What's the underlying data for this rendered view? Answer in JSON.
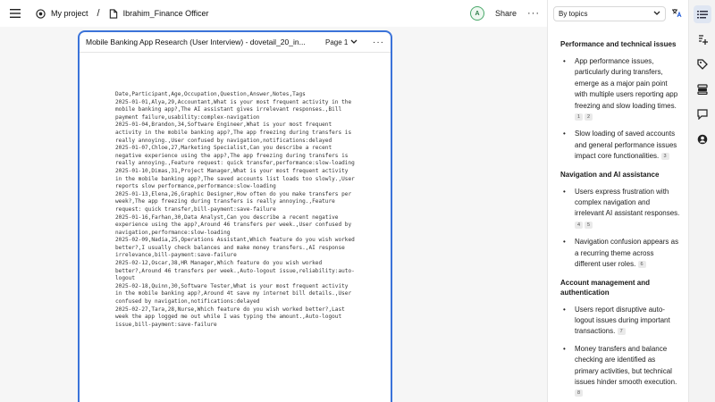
{
  "topbar": {
    "project": "My project",
    "separator": "/",
    "file": "Ibrahim_Finance Officer",
    "avatar_initial": "A",
    "share": "Share",
    "more": "···"
  },
  "document": {
    "title": "Mobile Banking App Research (User Interview) - dovetail_20_in...",
    "page_label": "Page 1",
    "more": "···",
    "csv": "Date,Participant,Age,Occupation,Question,Answer,Notes,Tags\n2025-01-01,Alya,29,Accountant,What is your most frequent activity in the mobile banking app?,The AI assistant gives irrelevant responses.,Bill payment failure,usability:complex-navigation\n2025-01-04,Brandon,34,Software Engineer,What is your most frequent activity in the mobile banking app?,The app freezing during transfers is really annoying.,User confused by navigation,notifications:delayed\n2025-01-07,Chloe,27,Marketing Specialist,Can you describe a recent negative experience using the app?,The app freezing during transfers is really annoying.,Feature request: quick transfer,performance:slow-loading\n2025-01-10,Dimas,31,Project Manager,What is your most frequent activity in the mobile banking app?,The saved accounts list loads too slowly.,User reports slow performance,performance:slow-loading\n2025-01-13,Elena,26,Graphic Designer,How often do you make transfers per week?,The app freezing during transfers is really annoying.,Feature request: quick transfer,bill-payment:save-failure\n2025-01-16,Farhan,30,Data Analyst,Can you describe a recent negative experience using the app?,Around 46 transfers per week.,User confused by navigation,performance:slow-loading\n2025-02-09,Nadia,25,Operations Assistant,Which feature do you wish worked better?,I usually check balances and make money transfers.,AI response irrelevance,bill-payment:save-failure\n2025-02-12,Oscar,38,HR Manager,Which feature do you wish worked better?,Around 46 transfers per week.,Auto-logout issue,reliability:auto-logout\n2025-02-18,Quinn,30,Software Tester,What is your most frequent activity in the mobile banking app?,Around 4t save my internet bill details.,User confused by navigation,notifications:delayed\n2025-02-27,Tara,28,Nurse,Which feature do you wish worked better?,Last week the app logged me out while I was typing the amount.,Auto-logout issue,bill-payment:save-failure"
  },
  "sidebar": {
    "selector": "By topics",
    "sections": [
      {
        "title": "Performance and technical issues",
        "bullets": [
          {
            "text": "App performance issues, particularly during transfers, emerge as a major pain point with multiple users reporting app freezing and slow loading times.",
            "cites": [
              "1",
              "2"
            ]
          },
          {
            "text": "Slow loading of saved accounts and general performance issues impact core functionalities.",
            "cites": [
              "3"
            ]
          }
        ]
      },
      {
        "title": "Navigation and AI assistance",
        "bullets": [
          {
            "text": "Users express frustration with complex navigation and irrelevant AI assistant responses.",
            "cites": [
              "4",
              "5"
            ]
          },
          {
            "text": "Navigation confusion appears as a recurring theme across different user roles.",
            "cites": [
              "6"
            ]
          }
        ]
      },
      {
        "title": "Account management and authentication",
        "bullets": [
          {
            "text": "Users report disruptive auto-logout issues during important transactions.",
            "cites": [
              "7"
            ]
          },
          {
            "text": "Money transfers and balance checking are identified as primary activities, but technical issues hinder smooth execution.",
            "cites": [
              "8"
            ]
          }
        ]
      }
    ]
  },
  "rail": {
    "icons": [
      "list-icon",
      "add-note-icon",
      "tag-icon",
      "layers-icon",
      "comment-icon",
      "user-icon"
    ]
  }
}
